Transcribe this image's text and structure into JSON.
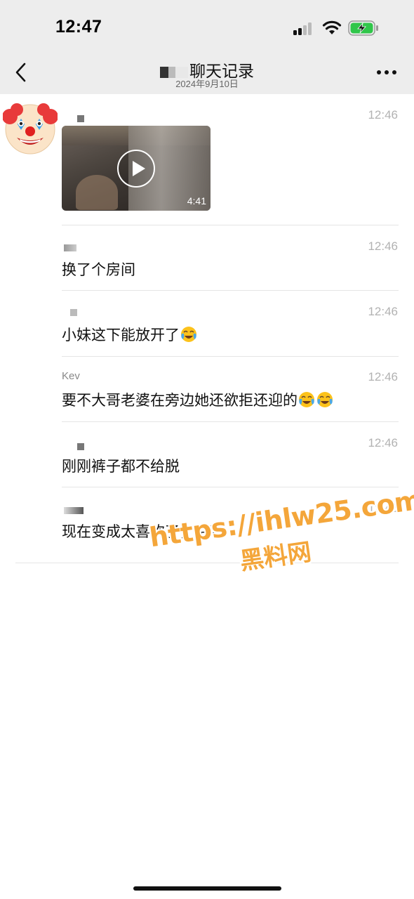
{
  "status_bar": {
    "time": "12:47",
    "icons": [
      "signal-icon",
      "wifi-icon",
      "battery-charging-icon"
    ],
    "battery_color": "#30c64a"
  },
  "nav": {
    "back_icon": "chevron-left-icon",
    "title": "聊天记录",
    "subtitle": "2024年9月10日",
    "more_icon": "more-horizontal-icon"
  },
  "colors": {
    "bar_background": "#ededed",
    "timestamp": "#b2b2b2",
    "watermark": "#f4a63a"
  },
  "messages": [
    {
      "sender": "",
      "time": "12:46",
      "type": "video",
      "video_duration": "4:41",
      "avatar_icon": "clown-face-icon"
    },
    {
      "sender": "",
      "time": "12:46",
      "type": "text",
      "text": "换了个房间"
    },
    {
      "sender": "",
      "time": "12:46",
      "type": "text",
      "text": "小妹这下能放开了",
      "emoji": [
        "face-with-tears-of-joy-icon"
      ]
    },
    {
      "sender": "Kev",
      "time": "12:46",
      "type": "text",
      "text": "要不大哥老婆在旁边她还欲拒还迎的",
      "emoji": [
        "face-with-tears-of-joy-icon",
        "face-with-tears-of-joy-icon"
      ]
    },
    {
      "sender": "",
      "time": "12:46",
      "type": "text",
      "text": "刚刚裤子都不给脱"
    },
    {
      "sender": "",
      "time": "12:46",
      "type": "text",
      "text": "现在变成太喜欢了，哈哈"
    }
  ],
  "watermark": {
    "url": "https://ihlw25.com",
    "name": "黑料网"
  }
}
